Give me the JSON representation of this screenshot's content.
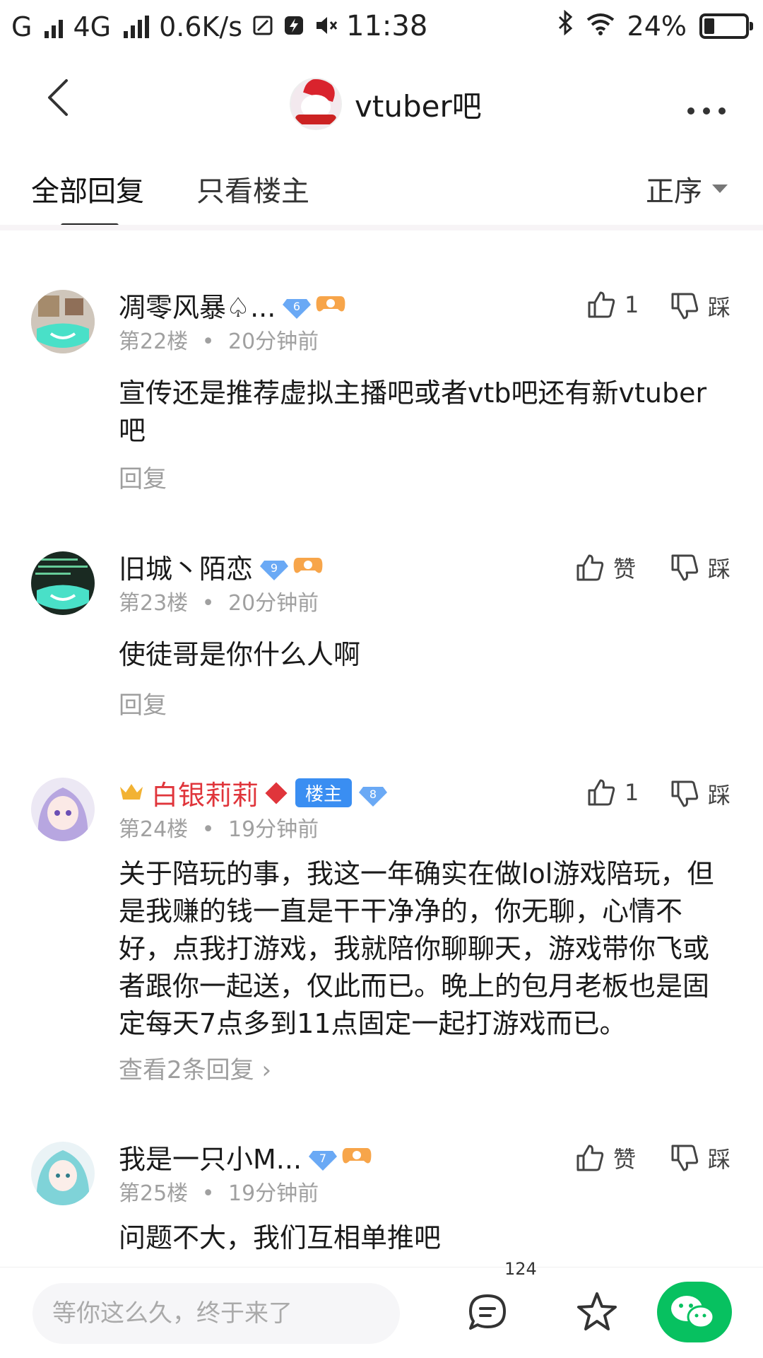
{
  "status_bar": {
    "left": [
      "G",
      "4G",
      "0.6K/s"
    ],
    "time": "11:38",
    "battery": "24%"
  },
  "header": {
    "forum_name": "vtuber吧",
    "back_icon": "chevron-left-icon",
    "more_icon": "more-dots-icon"
  },
  "tabs": {
    "all": "全部回复",
    "owner_only": "只看楼主",
    "sort": "正序"
  },
  "posts": [
    {
      "username": "凋零风暴♤...",
      "level": "6",
      "floor": "第22楼",
      "time": "20分钟前",
      "likes": "1",
      "dislike_label": "踩",
      "content": "宣传还是推荐虚拟主播吧或者vtb吧还有新vtuber吧",
      "reply_label": "回复"
    },
    {
      "username": "旧城丶陌恋",
      "level": "9",
      "floor": "第23楼",
      "time": "20分钟前",
      "likes": "赞",
      "dislike_label": "踩",
      "content": "使徒哥是你什么人啊",
      "reply_label": "回复"
    },
    {
      "username": "白银莉莉",
      "owner_tag": "楼主",
      "level": "8",
      "floor": "第24楼",
      "time": "19分钟前",
      "likes": "1",
      "dislike_label": "踩",
      "content": "关于陪玩的事，我这一年确实在做lol游戏陪玩，但是我赚的钱一直是干干净净的，你无聊，心情不好，点我打游戏，我就陪你聊聊天，游戏带你飞或者跟你一起送，仅此而已。晚上的包月老板也是固定每天7点多到11点固定一起打游戏而已。",
      "reply_label": "查看2条回复 ›"
    },
    {
      "username": "我是一只小M...",
      "level": "7",
      "floor": "第25楼",
      "time": "19分钟前",
      "likes": "赞",
      "dislike_label": "踩",
      "content": "问题不大，我们互相单推吧"
    }
  ],
  "bottom_bar": {
    "input_placeholder": "等你这么久，终于来了",
    "comment_count": "124"
  }
}
